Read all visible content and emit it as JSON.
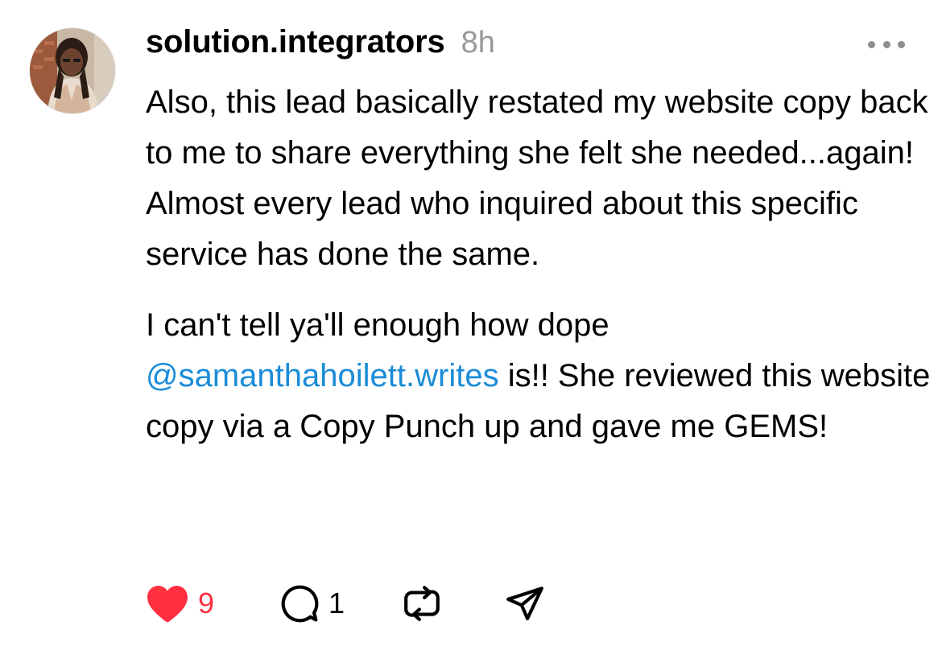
{
  "post": {
    "username": "solution.integrators",
    "timestamp": "8h",
    "avatar_icon": "profile-photo",
    "paragraph1": "Also, this lead basically restated my website copy back to me to share everything she felt she needed...again! Almost every lead who inquired about this specific service has done the same.",
    "paragraph2_before": "I can't tell ya'll enough how dope ",
    "mention": "@samanthahoilett.writes",
    "paragraph2_after": " is!! She reviewed this website copy via a Copy Punch up and gave me GEMS!"
  },
  "actions": {
    "like_count": "9",
    "reply_count": "1",
    "like_icon": "heart-filled-icon",
    "reply_icon": "speech-bubble-icon",
    "repost_icon": "repost-icon",
    "share_icon": "paper-plane-icon",
    "more_icon": "ellipsis-icon"
  },
  "colors": {
    "like": "#ff3040",
    "mention": "#1a8cd8",
    "timestamp": "#999999",
    "icon": "#000000"
  }
}
